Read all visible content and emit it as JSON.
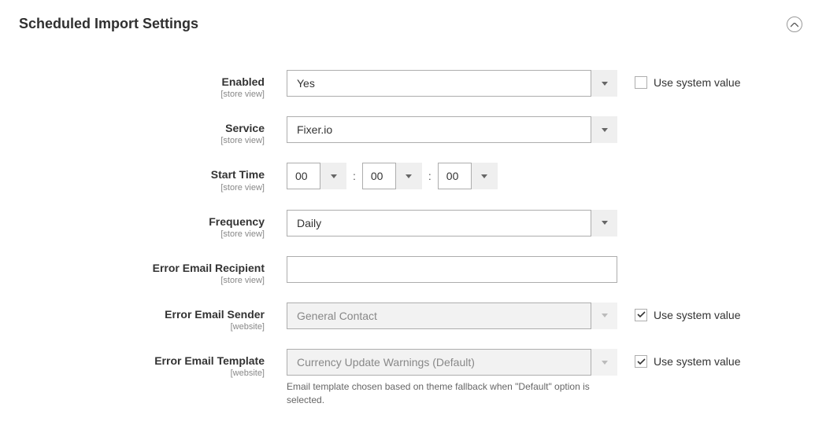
{
  "section": {
    "title": "Scheduled Import Settings"
  },
  "fields": {
    "enabled": {
      "label": "Enabled",
      "scope": "[store view]",
      "value": "Yes",
      "use_system_label": "Use system value"
    },
    "service": {
      "label": "Service",
      "scope": "[store view]",
      "value": "Fixer.io"
    },
    "start_time": {
      "label": "Start Time",
      "scope": "[store view]",
      "hour": "00",
      "minute": "00",
      "second": "00"
    },
    "frequency": {
      "label": "Frequency",
      "scope": "[store view]",
      "value": "Daily"
    },
    "error_recipient": {
      "label": "Error Email Recipient",
      "scope": "[store view]",
      "value": ""
    },
    "error_sender": {
      "label": "Error Email Sender",
      "scope": "[website]",
      "value": "General Contact",
      "use_system_label": "Use system value"
    },
    "error_template": {
      "label": "Error Email Template",
      "scope": "[website]",
      "value": "Currency Update Warnings (Default)",
      "use_system_label": "Use system value",
      "help": "Email template chosen based on theme fallback when \"Default\" option is selected."
    }
  }
}
